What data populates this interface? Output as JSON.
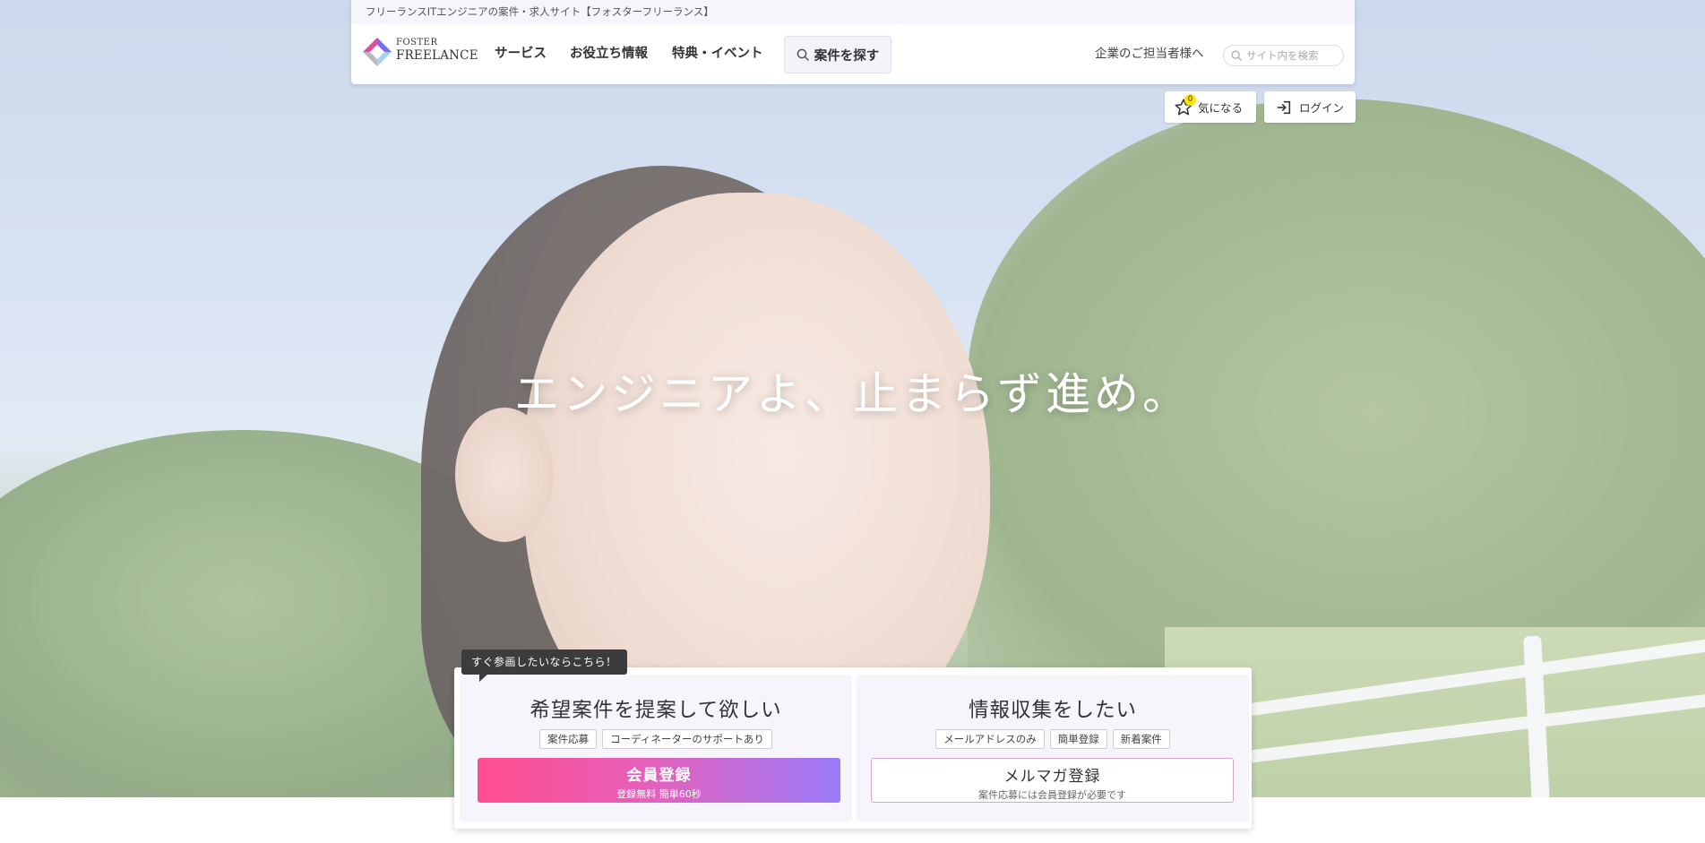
{
  "header": {
    "top_strip_text": "フリーランスITエンジニアの案件・求人サイト【フォスターフリーランス】",
    "logo": {
      "line1": "FOSTER",
      "line2": "FREELANCE",
      "icon": "foster-diamond-logo"
    },
    "nav": [
      {
        "label": "サービス"
      },
      {
        "label": "お役立ち情報"
      },
      {
        "label": "特典・イベント"
      }
    ],
    "search_jobs_label": "案件を探す",
    "corporate_link": "企業のご担当者様へ",
    "site_search_placeholder": "サイト内を検索"
  },
  "utility": {
    "favorites_label": "気になる",
    "favorites_count": "0",
    "login_label": "ログイン"
  },
  "hero": {
    "tagline": "エンジニアよ、止まらず進め。"
  },
  "registration": {
    "callout": "すぐ参画したいならこちら！",
    "left": {
      "title": "希望案件を提案して欲しい",
      "chips": [
        "案件応募",
        "コーディネーターのサポートあり"
      ],
      "cta_main": "会員登録",
      "cta_sub": "登録無料 簡単60秒"
    },
    "right": {
      "title": "情報収集をしたい",
      "chips": [
        "メールアドレスのみ",
        "簡単登録",
        "新着案件"
      ],
      "cta_main": "メルマガ登録",
      "cta_sub": "案件応募には会員登録が必要です"
    }
  },
  "colors": {
    "cta_gradient_start": "#ff4d8f",
    "cta_gradient_end": "#9b7bfb",
    "badge": "#ffe600",
    "callout_bg": "#3c3c3c"
  }
}
